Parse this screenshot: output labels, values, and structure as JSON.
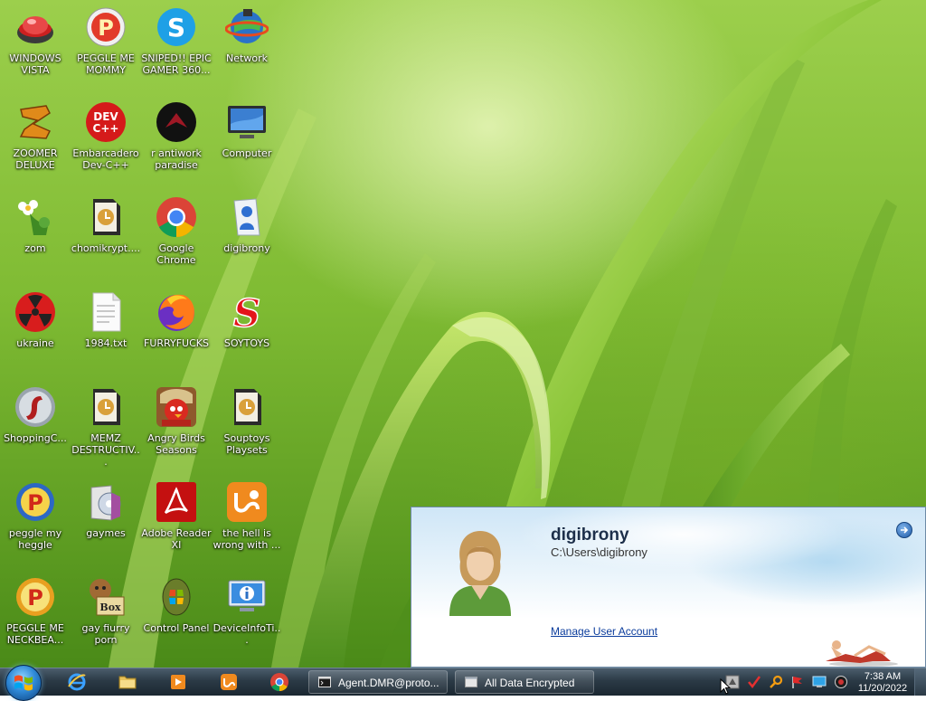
{
  "desktop": {
    "icons": [
      {
        "label": "WINDOWS VISTA",
        "icon": "red-bowl-app-icon"
      },
      {
        "label": "PEGGLE ME MOMMY",
        "icon": "peggle-p-icon"
      },
      {
        "label": "SNIPED!! EPIC GAMER 360...",
        "icon": "skype-icon"
      },
      {
        "label": "Network",
        "icon": "network-globe-icon"
      },
      {
        "label": "ZOOMER DELUXE",
        "icon": "zuma-icon"
      },
      {
        "label": "Embarcadero Dev-C++",
        "icon": "devcpp-icon"
      },
      {
        "label": "r antiwork paradise",
        "icon": "black-orb-icon"
      },
      {
        "label": "Computer",
        "icon": "computer-monitor-icon"
      },
      {
        "label": "zom",
        "icon": "plant-flower-icon"
      },
      {
        "label": "chomikrypt....",
        "icon": "hourglass-file-icon"
      },
      {
        "label": "Google Chrome",
        "icon": "chrome-icon"
      },
      {
        "label": "digibrony",
        "icon": "user-folder-icon"
      },
      {
        "label": "ukraine",
        "icon": "radiation-icon"
      },
      {
        "label": "1984.txt",
        "icon": "text-file-icon"
      },
      {
        "label": "FURRYFUCKS",
        "icon": "firefox-icon"
      },
      {
        "label": "SOYTOYS",
        "icon": "red-s-icon"
      },
      {
        "label": "ShoppingC...",
        "icon": "flash-icon"
      },
      {
        "label": "MEMZ DESTRUCTIV...",
        "icon": "hourglass-file-icon"
      },
      {
        "label": "Angry Birds Seasons",
        "icon": "angry-birds-icon"
      },
      {
        "label": "Souptoys Playsets",
        "icon": "hourglass-file-icon"
      },
      {
        "label": "peggle my heggle",
        "icon": "peggle-p-icon"
      },
      {
        "label": "gaymes",
        "icon": "games-folder-icon"
      },
      {
        "label": "Adobe Reader XI",
        "icon": "adobe-reader-icon"
      },
      {
        "label": "the hell is wrong with ...",
        "icon": "uc-browser-icon"
      },
      {
        "label": "PEGGLE ME NECKBEA...",
        "icon": "peggle-p-icon"
      },
      {
        "label": "gay fiurry porn",
        "icon": "winrar-box-icon"
      },
      {
        "label": "Control Panel",
        "icon": "control-panel-icon"
      },
      {
        "label": "DeviceInfoTi...",
        "icon": "device-info-icon"
      }
    ]
  },
  "user_panel": {
    "name": "digibrony",
    "path": "C:\\Users\\digibrony",
    "manage_link": "Manage User Account"
  },
  "taskbar": {
    "quick_launch": [
      "internet-explorer-icon",
      "folder-icon",
      "media-player-icon",
      "uc-browser-icon",
      "chrome-icon"
    ],
    "tasks": [
      {
        "label": "Agent.DMR@proto...",
        "icon": "console-window-icon"
      },
      {
        "label": "All Data Encrypted",
        "icon": "window-icon"
      }
    ],
    "tray": [
      "tray-app-icon",
      "check-icon",
      "search-key-icon",
      "flag-icon",
      "network-monitor-icon",
      "volume-icon"
    ],
    "clock": {
      "time": "7:38 AM",
      "date": "11/20/2022"
    }
  }
}
